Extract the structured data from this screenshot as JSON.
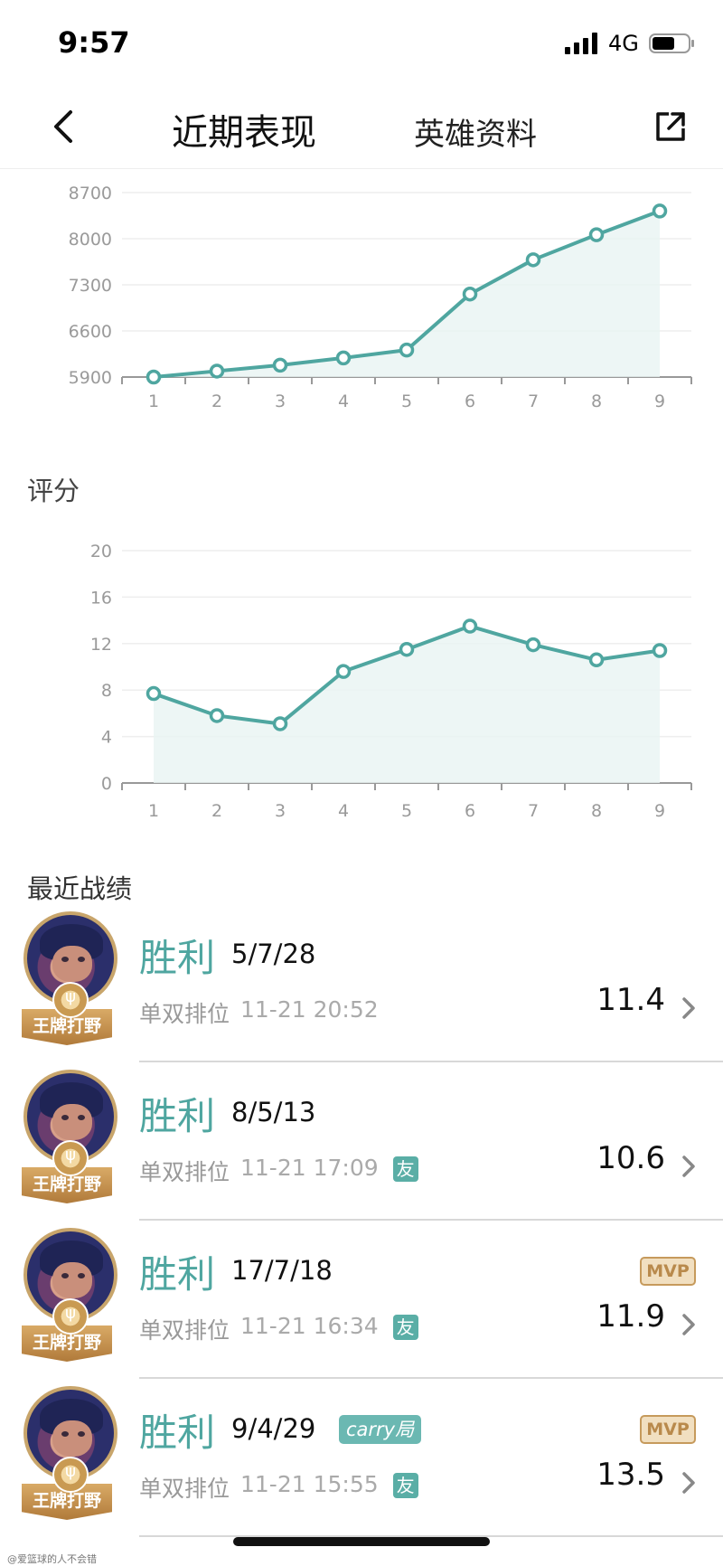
{
  "status_bar": {
    "time": "9:57",
    "network": "4G"
  },
  "nav": {
    "title": "近期表现",
    "tab_hero": "英雄资料"
  },
  "charts": {
    "rating_section_label": "评分",
    "records_section_label": "最近战绩"
  },
  "chart_data": [
    {
      "type": "area",
      "title": "",
      "xlabel": "",
      "ylabel": "",
      "x": [
        1,
        2,
        3,
        4,
        5,
        6,
        7,
        8,
        9
      ],
      "series": [
        {
          "values": [
            5880,
            5990,
            6080,
            6190,
            6310,
            7160,
            7680,
            8060,
            8420
          ]
        }
      ],
      "y_ticks": [
        5900,
        6600,
        7300,
        8000,
        8700
      ],
      "ylim": [
        5900,
        8700
      ],
      "grid": true,
      "color": "#4fa6a0"
    },
    {
      "type": "area",
      "title": "评分",
      "xlabel": "",
      "ylabel": "",
      "x": [
        1,
        2,
        3,
        4,
        5,
        6,
        7,
        8,
        9
      ],
      "series": [
        {
          "values": [
            7.7,
            5.8,
            5.1,
            9.6,
            11.5,
            13.5,
            11.9,
            10.6,
            11.4
          ]
        }
      ],
      "y_ticks": [
        0,
        4,
        8,
        12,
        16,
        20
      ],
      "ylim": [
        0,
        20
      ],
      "grid": true,
      "color": "#4fa6a0"
    }
  ],
  "records": [
    {
      "rank_label": "王牌打野",
      "emblem": "ψ",
      "result": "胜利",
      "kda": "5/7/28",
      "mode": "单双排位",
      "time": "11-21 20:52",
      "friend": "",
      "carry": "",
      "mvp": "",
      "score": "11.4"
    },
    {
      "rank_label": "王牌打野",
      "emblem": "ψ",
      "result": "胜利",
      "kda": "8/5/13",
      "mode": "单双排位",
      "time": "11-21 17:09",
      "friend": "友",
      "carry": "",
      "mvp": "",
      "score": "10.6"
    },
    {
      "rank_label": "王牌打野",
      "emblem": "ψ",
      "result": "胜利",
      "kda": "17/7/18",
      "mode": "单双排位",
      "time": "11-21 16:34",
      "friend": "友",
      "carry": "",
      "mvp": "MVP",
      "score": "11.9"
    },
    {
      "rank_label": "王牌打野",
      "emblem": "ψ",
      "result": "胜利",
      "kda": "9/4/29",
      "mode": "单双排位",
      "time": "11-21 15:55",
      "friend": "友",
      "carry": "carry局",
      "mvp": "MVP",
      "score": "13.5"
    }
  ],
  "watermark": "@爱篮球的人不会错",
  "icons": {
    "back": "chevron-left-icon",
    "share": "share-icon",
    "arrow": "chevron-right-icon"
  }
}
